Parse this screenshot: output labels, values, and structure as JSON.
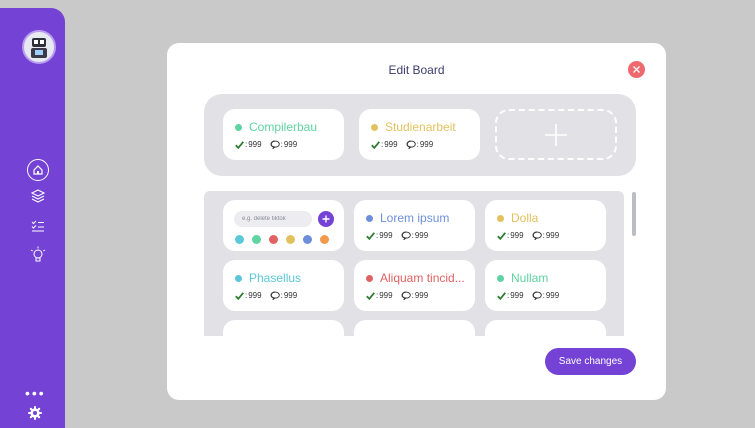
{
  "modal": {
    "title": "Edit Board",
    "save_label": "Save changes",
    "input_placeholder": "e.g. delete tiktok"
  },
  "top_categories": [
    {
      "name": "Compilerbau",
      "color": "#5fd3a1",
      "done": "999",
      "comments": "999"
    },
    {
      "name": "Studienarbeit",
      "color": "#e2c25f",
      "done": "999",
      "comments": "999"
    }
  ],
  "grid_categories": [
    {
      "name": "Lorem ipsum",
      "color": "#6d8fd9",
      "done": "999",
      "comments": "999"
    },
    {
      "name": "Dolla",
      "color": "#e2c25f",
      "done": "999",
      "comments": "999"
    },
    {
      "name": "Phasellus",
      "color": "#5bc8d8",
      "done": "999",
      "comments": "999"
    },
    {
      "name": "Aliquam tincid...",
      "color": "#e06262",
      "done": "999",
      "comments": "999"
    },
    {
      "name": "Nullam",
      "color": "#5fd3a1",
      "done": "999",
      "comments": "999"
    }
  ],
  "swatch_colors": [
    "#5bc8d8",
    "#5fd3a1",
    "#e06262",
    "#e2c25f",
    "#6d8fd9",
    "#f29a4a"
  ],
  "stat_separator": ":",
  "icons": {
    "done": "check-icon",
    "comments": "comment-icon",
    "nav": [
      "home-icon",
      "layers-icon",
      "checklist-icon",
      "lightbulb-icon"
    ],
    "settings": "gear-icon",
    "more": "more-dots-icon"
  },
  "colors": {
    "accent": "#7442d4",
    "close": "#ee6a6e",
    "check": "#2f7d32"
  }
}
